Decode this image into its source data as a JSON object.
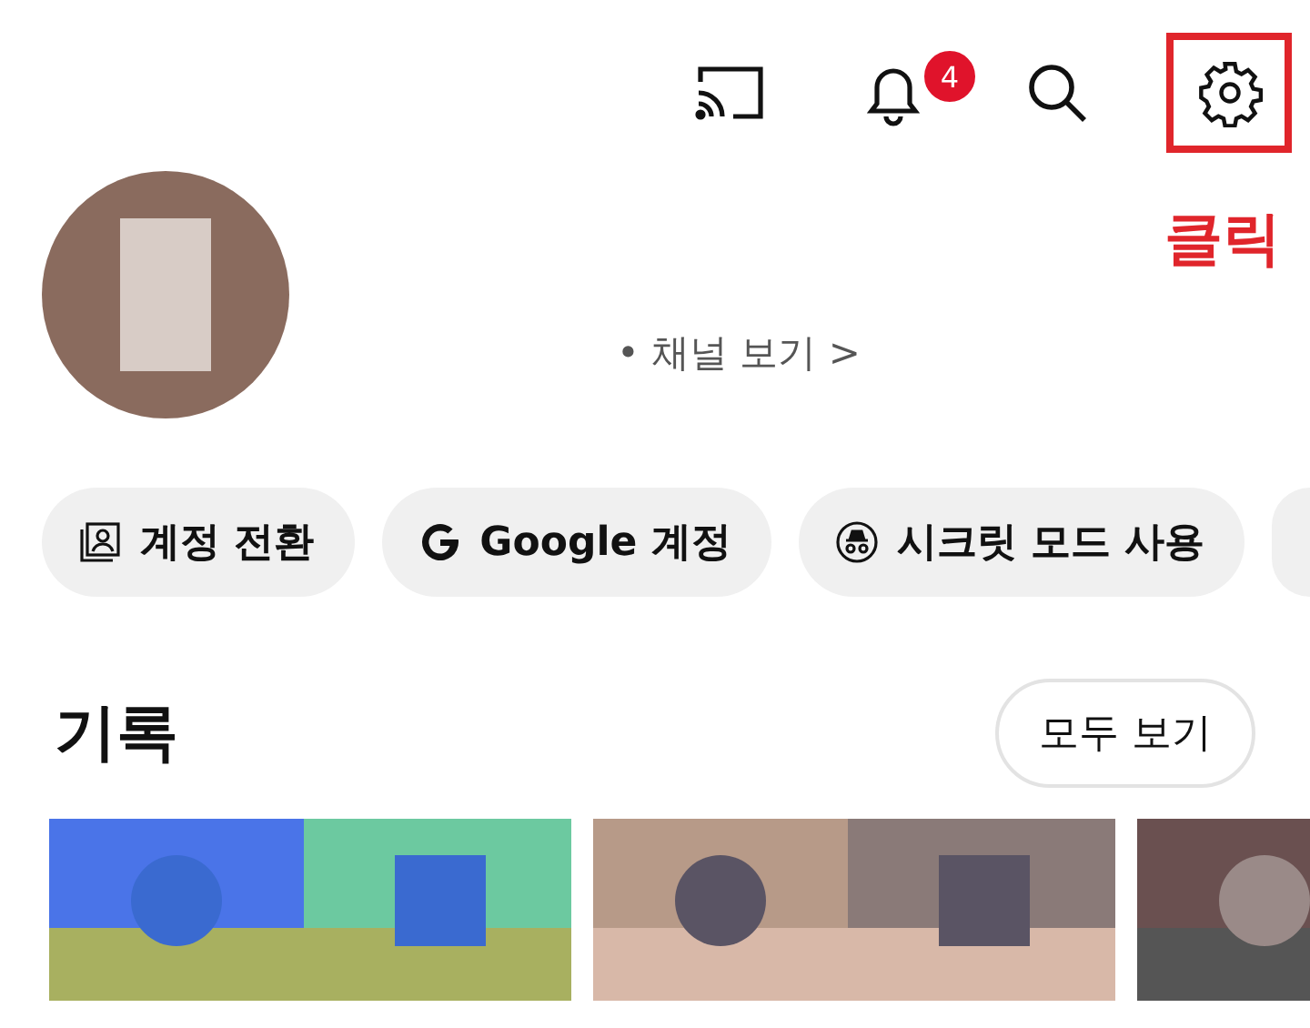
{
  "top_bar": {
    "icons": [
      {
        "kind": "cast",
        "highlighted": false
      },
      {
        "kind": "notifications",
        "highlighted": false,
        "count": "4"
      },
      {
        "kind": "search",
        "highlighted": false
      },
      {
        "kind": "settings",
        "highlighted": true
      }
    ]
  },
  "annotation": {
    "text": "클릭"
  },
  "profile": {
    "channel_link": "• 채널 보기 >"
  },
  "chips": [
    {
      "kind": "switch",
      "label": "계정 전환"
    },
    {
      "kind": "google",
      "label": "Google 계정"
    },
    {
      "kind": "incognito",
      "label": "시크릿 모드 사용"
    },
    {
      "kind": "partial"
    }
  ],
  "history": {
    "title": "기록",
    "view_all": "모두 보기"
  }
}
